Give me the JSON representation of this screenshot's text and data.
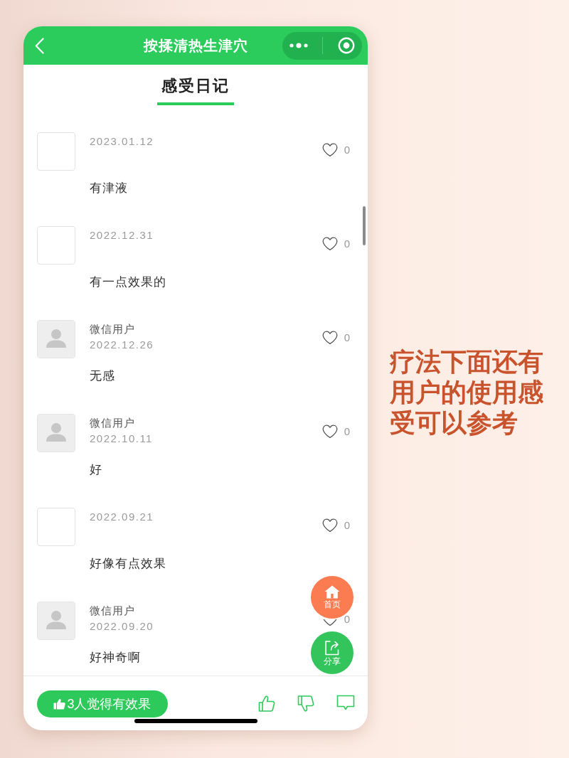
{
  "header": {
    "title": "按揉清热生津穴"
  },
  "tabs": [
    {
      "label": "感受日记",
      "selected": true
    }
  ],
  "entries": [
    {
      "kind": "anonymous",
      "date": "2023.01.12",
      "likes": "0",
      "text": "有津液"
    },
    {
      "kind": "anonymous",
      "date": "2022.12.31",
      "likes": "0",
      "text": "有一点效果的"
    },
    {
      "kind": "user",
      "name": "微信用户",
      "date": "2022.12.26",
      "likes": "0",
      "text": "无感"
    },
    {
      "kind": "user",
      "name": "微信用户",
      "date": "2022.10.11",
      "likes": "0",
      "text": "好"
    },
    {
      "kind": "anonymous",
      "date": "2022.09.21",
      "likes": "0",
      "text": "好像有点效果"
    },
    {
      "kind": "user",
      "name": "微信用户",
      "date": "2022.09.20",
      "likes": "0",
      "text": "好神奇啊"
    }
  ],
  "floating_buttons": [
    {
      "kind": "home",
      "label": "首页"
    },
    {
      "kind": "share",
      "label": "分享"
    }
  ],
  "footer": {
    "effective_button": "3人觉得有效果",
    "actions": [
      {
        "kind": "like"
      },
      {
        "kind": "dislike"
      },
      {
        "kind": "comment"
      }
    ]
  },
  "caption": "疗法下面还有用户的使用感受可以参考"
}
